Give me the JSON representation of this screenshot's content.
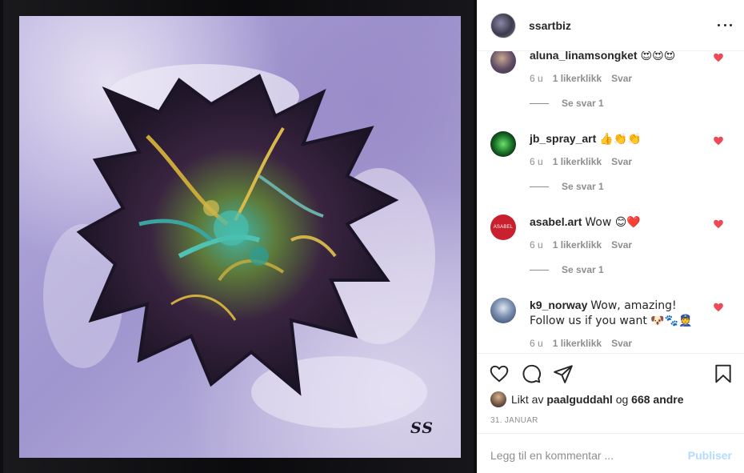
{
  "post": {
    "username": "ssartbiz",
    "artwork": {
      "signature": "SS"
    }
  },
  "comments": [
    {
      "username": "aluna_linamsongket",
      "text": "😍😍😍",
      "time": "6 u",
      "likes": "1 likerklikk",
      "reply": "Svar",
      "replies": "Se svar 1",
      "liked": true
    },
    {
      "username": "jb_spray_art",
      "text": "👍👏👏",
      "time": "6 u",
      "likes": "1 likerklikk",
      "reply": "Svar",
      "replies": "Se svar 1",
      "liked": true
    },
    {
      "username": "asabel.art",
      "text": "Wow 😊❤️",
      "avatar_text": "ASABEL",
      "time": "6 u",
      "likes": "1 likerklikk",
      "reply": "Svar",
      "replies": "Se svar 1",
      "liked": true
    },
    {
      "username": "k9_norway",
      "text": "Wow, amazing! Follow us if you want 🐶🐾👮",
      "time": "6 u",
      "likes": "1 likerklikk",
      "reply": "Svar",
      "liked": true
    }
  ],
  "actions": {
    "icons": [
      "heart-icon",
      "comment-icon",
      "share-icon",
      "bookmark-icon"
    ]
  },
  "likes": {
    "prefix": "Likt av",
    "user": "paalguddahl",
    "joiner": "og",
    "others": "668 andre"
  },
  "date": "31. JANUAR",
  "composer": {
    "placeholder": "Legg til en kommentar ...",
    "post_label": "Publiser"
  },
  "colors": {
    "liked_heart": "#ed4956",
    "post_button_disabled": "#b3dbff",
    "muted_text": "#8e8e8e"
  }
}
